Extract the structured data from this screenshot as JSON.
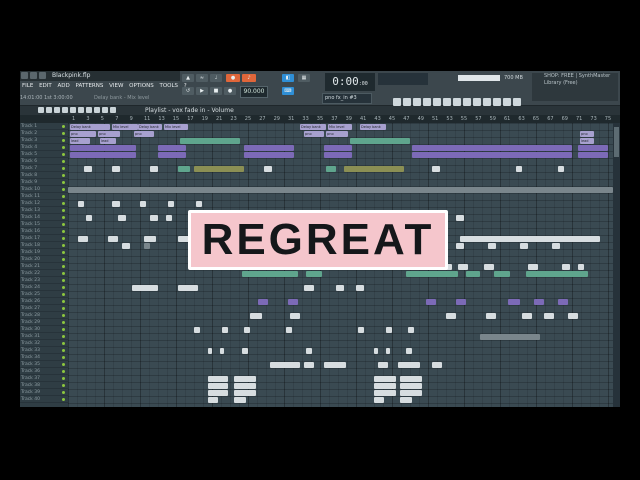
{
  "window": {
    "title": "Blackpink.flp",
    "menu": [
      "FILE",
      "EDIT",
      "ADD",
      "PATTERNS",
      "VIEW",
      "OPTIONS",
      "TOOLS",
      "?"
    ],
    "position_text": "14:01:00 1st 3:00:00",
    "hint_text": "Delay bank - Mix level"
  },
  "transport": {
    "tempo": "90.000",
    "time_main": "0:00",
    "time_sub": "00",
    "pattern_selector": "pno fx_in #3",
    "ram": "700 MB",
    "news_lines": [
      "SHOP: FREE | SynthMaster",
      "Library (Free)"
    ]
  },
  "playlist": {
    "breadcrumb": "Playlist - vox fade in - Volume",
    "ruler": [
      "1",
      "3",
      "5",
      "7",
      "9",
      "11",
      "13",
      "15",
      "17",
      "19",
      "21",
      "23",
      "25",
      "27",
      "29",
      "31",
      "33",
      "35",
      "37",
      "39",
      "41",
      "43",
      "45",
      "47",
      "49",
      "51",
      "53",
      "55",
      "57",
      "59",
      "61",
      "63",
      "65",
      "67",
      "69",
      "71",
      "73",
      "75"
    ],
    "tracks": [
      "Track 1",
      "Track 2",
      "Track 3",
      "Track 4",
      "Track 5",
      "Track 6",
      "Track 7",
      "Track 8",
      "Track 9",
      "Track 10",
      "Track 11",
      "Track 12",
      "Track 13",
      "Track 14",
      "Track 15",
      "Track 16",
      "Track 17",
      "Track 18",
      "Track 19",
      "Track 20",
      "Track 21",
      "Track 22",
      "Track 23",
      "Track 24",
      "Track 25",
      "Track 26",
      "Track 27",
      "Track 28",
      "Track 29",
      "Track 30",
      "Track 31",
      "Track 32",
      "Track 33",
      "Track 34",
      "Track 35",
      "Track 36",
      "Track 37",
      "Track 38",
      "Track 39",
      "Track 40"
    ],
    "clip_labels": {
      "delay_bank": "Delay bank",
      "mix_level": "Mix level",
      "pno": "pno",
      "lead": "lead"
    }
  },
  "watermark": {
    "text": "REGREAT"
  },
  "colors": {
    "clip_lavender": "#a7a0cf",
    "clip_purple": "#7c6ab7",
    "clip_teal": "#5fa58d",
    "accent_orange": "#e0663a",
    "logo_pink": "#f5c6cc"
  }
}
